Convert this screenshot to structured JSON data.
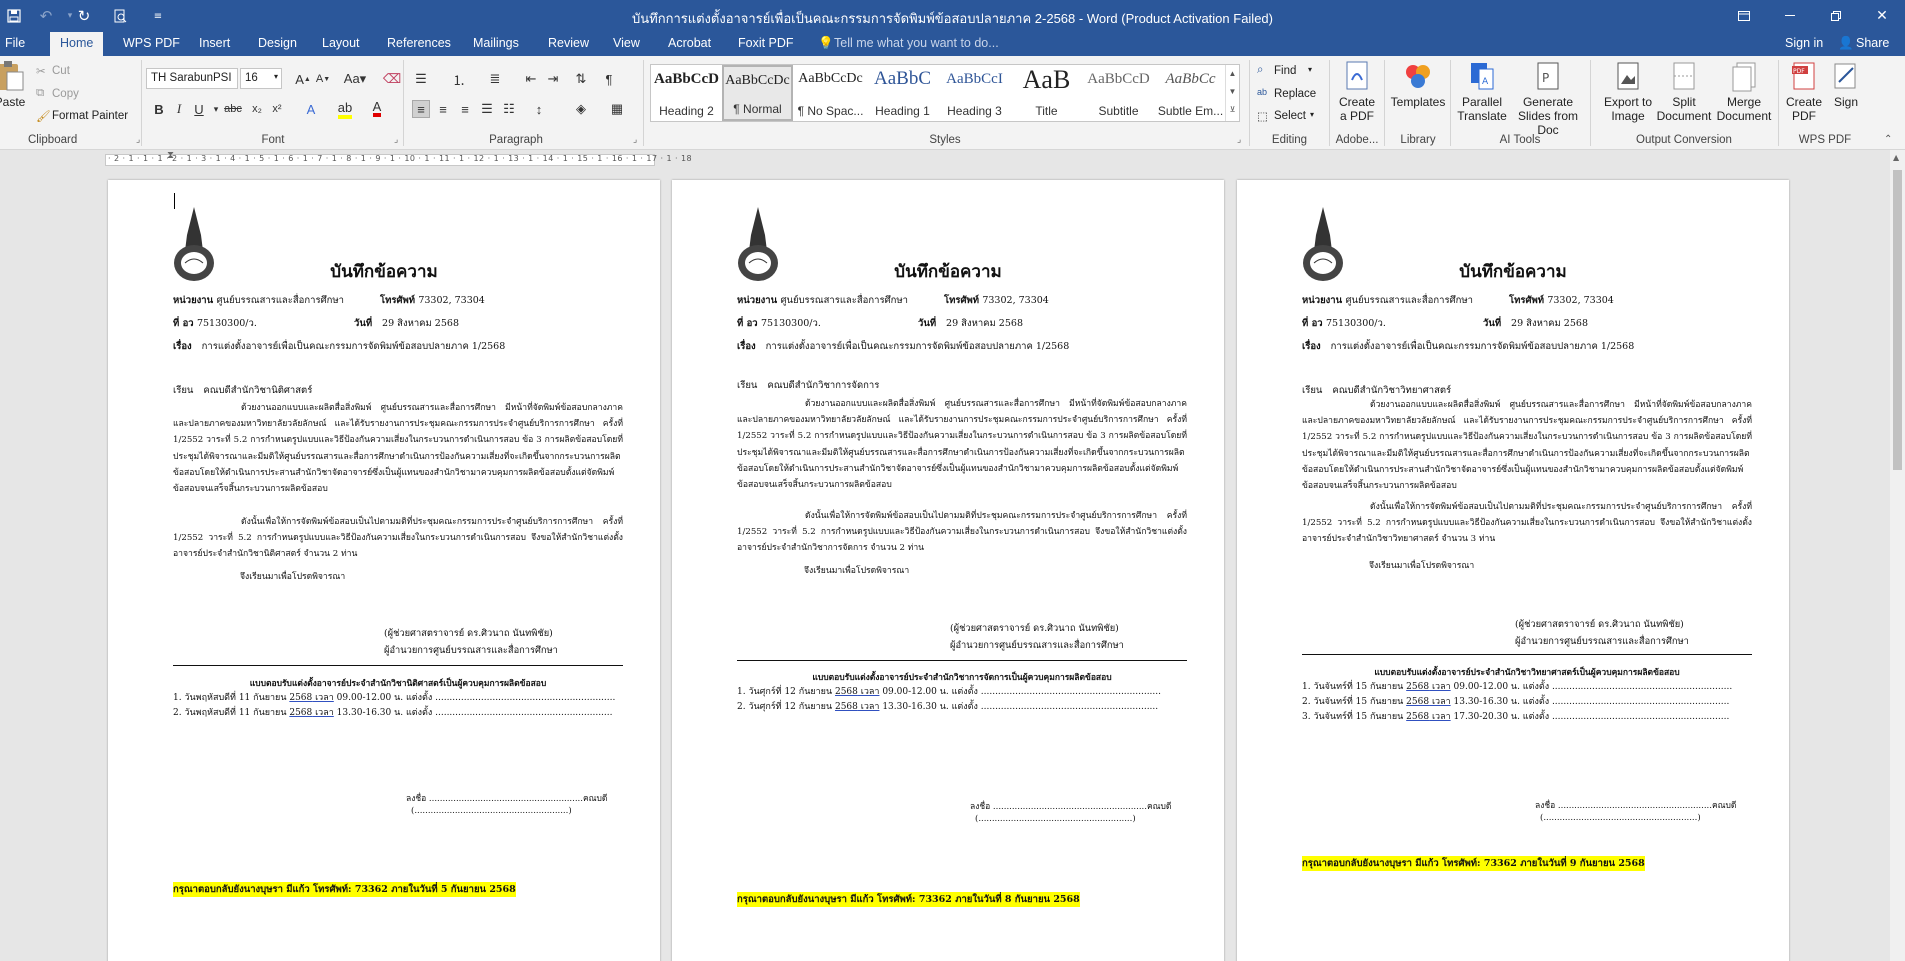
{
  "window": {
    "title": "บันทึกการแต่งตั้งอาจารย์เพื่อเป็นคณะกรรมการจัดพิมพ์ข้อสอบปลายภาค  2-2568 - Word (Product Activation Failed)"
  },
  "tabs": [
    "File",
    "Home",
    "WPS PDF",
    "Insert",
    "Design",
    "Layout",
    "References",
    "Mailings",
    "Review",
    "View",
    "Acrobat",
    "Foxit PDF"
  ],
  "active_tab": "Home",
  "tell_me": "Tell me what you want to do...",
  "account": {
    "sign_in": "Sign in",
    "share": "Share"
  },
  "clipboard": {
    "paste": "Paste",
    "cut": "Cut",
    "copy": "Copy",
    "format_painter": "Format Painter",
    "label": "Clipboard"
  },
  "font": {
    "name": "TH SarabunPSI",
    "size": "16",
    "label": "Font"
  },
  "paragraph": {
    "label": "Paragraph"
  },
  "styles": {
    "label": "Styles",
    "items": [
      {
        "preview": "AaBbCcD",
        "name": "Heading 2"
      },
      {
        "preview": "AaBbCcDc",
        "name": "¶ Normal"
      },
      {
        "preview": "AaBbCcDc",
        "name": "¶ No Spac..."
      },
      {
        "preview": "AaBbC",
        "name": "Heading 1"
      },
      {
        "preview": "AaBbCcI",
        "name": "Heading 3"
      },
      {
        "preview": "AaB",
        "name": "Title"
      },
      {
        "preview": "AaBbCcD",
        "name": "Subtitle"
      },
      {
        "preview": "AaBbCc",
        "name": "Subtle Em..."
      }
    ]
  },
  "editing": {
    "find": "Find",
    "replace": "Replace",
    "select": "Select",
    "label": "Editing"
  },
  "adobe": {
    "create_pdf": "Create a PDF",
    "label": "Adobe..."
  },
  "library": {
    "templates": "Templates",
    "label": "Library"
  },
  "ai_tools": {
    "parallel": "Parallel Translate",
    "slides": "Generate Slides from Doc",
    "label": "AI Tools"
  },
  "output": {
    "export": "Export to Image",
    "split": "Split Document",
    "merge": "Merge Document",
    "label": "Output Conversion"
  },
  "wps_pdf": {
    "create": "Create PDF",
    "sign": "Sign",
    "label": "WPS PDF"
  },
  "ruler_marks": "· 2 · 1 · 1 · 1 · 2 · 1 · 3 · 1 · 4 · 1 · 5 · 1 · 6 · 1 · 7 · 1 · 8 · 1 · 9 · 1 · 10 · 1 · 11 · 1 · 12 · 1 · 13 · 1 · 14 · 1 · 15 · 1 · 16 · 1 · 17 · 1 · 18",
  "pages": [
    {
      "title": "บันทึกข้อความ",
      "dept_label": "หน่วยงาน",
      "dept": "ศูนย์บรรณสารและสื่อการศึกษา",
      "phone_label": "โทรศัพท์",
      "phone": "73302, 73304",
      "ref_label": "ที่ อว",
      "ref": "75130300/ว.",
      "date_label": "วันที่",
      "date": "29 สิงหาคม 2568",
      "subject_label": "เรื่อง",
      "subject": "การแต่งตั้งอาจารย์เพื่อเป็นคณะกรรมการจัดพิมพ์ข้อสอบปลายภาค  1/2568",
      "to_label": "เรียน",
      "to": "คณบดีสำนักวิชานิติศาสตร์",
      "body1": "ด้วยงานออกแบบและผลิตสื่อสิ่งพิมพ์ ศูนย์บรรณสารและสื่อการศึกษา  มีหน้าที่จัดพิมพ์ข้อสอบกลางภาคและปลายภาคของมหาวิทยาลัยวลัยลักษณ์  และได้รับรายงานการประชุมคณะกรรมการประจำศูนย์บริการการศึกษา ครั้งที่ 1/2552 วาระที่ 5.2 การกำหนดรูปแบบและวิธีป้องกันความเสี่ยงในกระบวนการดำเนินการสอบ ข้อ 3 การผลิตข้อสอบโดยที่ประชุมได้พิจารณาและมีมติให้ศูนย์บรรณสารและสื่อการศึกษาดำเนินการป้องกันความเสี่ยงที่จะเกิดขึ้นจากกระบวนการผลิตข้อสอบโดยให้ดำเนินการประสานสำนักวิชาจัดอาจารย์ซึ่งเป็นผู้แทนของสำนักวิชามาควบคุมการผลิตข้อสอบตั้งแต่จัดพิมพ์ข้อสอบจนเสร็จสิ้นกระบวนการผลิตข้อสอบ",
      "body2": "ดังนั้นเพื่อให้การจัดพิมพ์ข้อสอบเป็นไปตามมติที่ประชุมคณะกรรมการประจำศูนย์บริการการศึกษา ครั้งที่ 1/2552 วาระที่ 5.2 การกำหนดรูปแบบและวิธีป้องกันความเสี่ยงในกระบวนการดำเนินการสอบ จึงขอให้สำนักวิชาแต่งตั้งอาจารย์ประจำสำนักวิชานิติศาสตร์ จำนวน 2 ท่าน",
      "closing": "จึงเรียนมาเพื่อโปรดพิจารณา",
      "signer": "(ผู้ช่วยศาสตราจารย์ ดร.ศิวนาถ  นันทพิชัย)",
      "signer_title": "ผู้อำนวยการศูนย์บรรณสารและสื่อการศึกษา",
      "form_title": "แบบตอบรับแต่งตั้งอาจารย์ประจำสำนักวิชานิติศาสตร์เป็นผู้ควบคุมการผลิตข้อสอบ",
      "slots": [
        {
          "pre": "1. วันพฤหัสบดีที่ 11 กันยายน ",
          "yr": "2568",
          "mid": " เวลา",
          "post": " 09.00-12.00 น. แต่งตั้ง ..............................................................."
        },
        {
          "pre": "2. วันพฤหัสบดีที่ 11 กันยายน ",
          "yr": "2568",
          "mid": " เวลา",
          "post": " 13.30-16.30 น. แต่งตั้ง .............................................................."
        }
      ],
      "sign": "ลงชื่อ .........................................................คณบดี",
      "sign_name": "(.........................................................)",
      "highlight": "กรุณาตอบกลับยังนางบุษรา  มีแก้ว โทรศัพท์: 73362 ภายในวันที่  5 กันยายน 2568"
    },
    {
      "title": "บันทึกข้อความ",
      "dept_label": "หน่วยงาน",
      "dept": "ศูนย์บรรณสารและสื่อการศึกษา",
      "phone_label": "โทรศัพท์",
      "phone": "73302, 73304",
      "ref_label": "ที่ อว",
      "ref": "75130300/ว.",
      "date_label": "วันที่",
      "date": "29 สิงหาคม 2568",
      "subject_label": "เรื่อง",
      "subject": "การแต่งตั้งอาจารย์เพื่อเป็นคณะกรรมการจัดพิมพ์ข้อสอบปลายภาค  1/2568",
      "to_label": "เรียน",
      "to": "คณบดีสำนักวิชาการจัดการ",
      "body1": "ด้วยงานออกแบบและผลิตสื่อสิ่งพิมพ์ ศูนย์บรรณสารและสื่อการศึกษา  มีหน้าที่จัดพิมพ์ข้อสอบกลางภาคและปลายภาคของมหาวิทยาลัยวลัยลักษณ์  และได้รับรายงานการประชุมคณะกรรมการประจำศูนย์บริการการศึกษา ครั้งที่ 1/2552 วาระที่ 5.2 การกำหนดรูปแบบและวิธีป้องกันความเสี่ยงในกระบวนการดำเนินการสอบ ข้อ 3 การผลิตข้อสอบโดยที่ประชุมได้พิจารณาและมีมติให้ศูนย์บรรณสารและสื่อการศึกษาดำเนินการป้องกันความเสี่ยงที่จะเกิดขึ้นจากกระบวนการผลิตข้อสอบโดยให้ดำเนินการประสานสำนักวิชาจัดอาจารย์ซึ่งเป็นผู้แทนของสำนักวิชามาควบคุมการผลิตข้อสอบตั้งแต่จัดพิมพ์ข้อสอบจนเสร็จสิ้นกระบวนการผลิตข้อสอบ",
      "body2": "ดังนั้นเพื่อให้การจัดพิมพ์ข้อสอบเป็นไปตามมติที่ประชุมคณะกรรมการประจำศูนย์บริการการศึกษา ครั้งที่ 1/2552 วาระที่ 5.2 การกำหนดรูปแบบและวิธีป้องกันความเสี่ยงในกระบวนการดำเนินการสอบ จึงขอให้สำนักวิชาแต่งตั้งอาจารย์ประจำสำนักวิชาการจัดการ จำนวน 2 ท่าน",
      "closing": "จึงเรียนมาเพื่อโปรดพิจารณา",
      "signer": "(ผู้ช่วยศาสตราจารย์ ดร.ศิวนาถ  นันทพิชัย)",
      "signer_title": "ผู้อำนวยการศูนย์บรรณสารและสื่อการศึกษา",
      "form_title": "แบบตอบรับแต่งตั้งอาจารย์ประจำสำนักวิชาการจัดการเป็นผู้ควบคุมการผลิตข้อสอบ",
      "slots": [
        {
          "pre": "1. วันศุกร์ที่ 12 กันยายน ",
          "yr": "2568",
          "mid": " เวลา",
          "post": " 09.00-12.00 น. แต่งตั้ง ..............................................................."
        },
        {
          "pre": "2. วันศุกร์ที่ 12 กันยายน ",
          "yr": "2568",
          "mid": " เวลา",
          "post": " 13.30-16.30 น. แต่งตั้ง .............................................................."
        }
      ],
      "sign": "ลงชื่อ .........................................................คณบดี",
      "sign_name": "(.........................................................)",
      "highlight": "กรุณาตอบกลับยังนางบุษรา  มีแก้ว โทรศัพท์: 73362 ภายในวันที่  8 กันยายน 2568"
    },
    {
      "title": "บันทึกข้อความ",
      "dept_label": "หน่วยงาน",
      "dept": "ศูนย์บรรณสารและสื่อการศึกษา",
      "phone_label": "โทรศัพท์",
      "phone": "73302, 73304",
      "ref_label": "ที่ อว",
      "ref": "75130300/ว.",
      "date_label": "วันที่",
      "date": "29 สิงหาคม 2568",
      "subject_label": "เรื่อง",
      "subject": "การแต่งตั้งอาจารย์เพื่อเป็นคณะกรรมการจัดพิมพ์ข้อสอบปลายภาค  1/2568",
      "to_label": "เรียน",
      "to": "คณบดีสำนักวิชาวิทยาศาสตร์",
      "body1": "ด้วยงานออกแบบและผลิตสื่อสิ่งพิมพ์ ศูนย์บรรณสารและสื่อการศึกษา  มีหน้าที่จัดพิมพ์ข้อสอบกลางภาคและปลายภาคของมหาวิทยาลัยวลัยลักษณ์  และได้รับรายงานการประชุมคณะกรรมการประจำศูนย์บริการการศึกษา ครั้งที่ 1/2552 วาระที่ 5.2 การกำหนดรูปแบบและวิธีป้องกันความเสี่ยงในกระบวนการดำเนินการสอบ ข้อ 3 การผลิตข้อสอบโดยที่ประชุมได้พิจารณาและมีมติให้ศูนย์บรรณสารและสื่อการศึกษาดำเนินการป้องกันความเสี่ยงที่จะเกิดขึ้นจากกระบวนการผลิตข้อสอบโดยให้ดำเนินการประสานสำนักวิชาจัดอาจารย์ซึ่งเป็นผู้แทนของสำนักวิชามาควบคุมการผลิตข้อสอบตั้งแต่จัดพิมพ์ข้อสอบจนเสร็จสิ้นกระบวนการผลิตข้อสอบ",
      "body2": "ดังนั้นเพื่อให้การจัดพิมพ์ข้อสอบเป็นไปตามมติที่ประชุมคณะกรรมการประจำศูนย์บริการการศึกษา ครั้งที่ 1/2552 วาระที่ 5.2 การกำหนดรูปแบบและวิธีป้องกันความเสี่ยงในกระบวนการดำเนินการสอบ จึงขอให้สำนักวิชาแต่งตั้งอาจารย์ประจำสำนักวิชาวิทยาศาสตร์ จำนวน 3 ท่าน",
      "closing": "จึงเรียนมาเพื่อโปรดพิจารณา",
      "signer": "(ผู้ช่วยศาสตราจารย์ ดร.ศิวนาถ  นันทพิชัย)",
      "signer_title": "ผู้อำนวยการศูนย์บรรณสารและสื่อการศึกษา",
      "form_title": "แบบตอบรับแต่งตั้งอาจารย์ประจำสำนักวิชาวิทยาศาสตร์เป็นผู้ควบคุมการผลิตข้อสอบ",
      "slots": [
        {
          "pre": "1. วันจันทร์ที่ 15 กันยายน ",
          "yr": "2568",
          "mid": " เวลา",
          "post": " 09.00-12.00 น. แต่งตั้ง ..............................................................."
        },
        {
          "pre": "2. วันจันทร์ที่ 15 กันยายน ",
          "yr": "2568",
          "mid": " เวลา",
          "post": " 13.30-16.30 น. แต่งตั้ง .............................................................."
        },
        {
          "pre": "3. วันจันทร์ที่ 15 กันยายน ",
          "yr": "2568",
          "mid": " เวลา",
          "post": " 17.30-20.30 น. แต่งตั้ง .............................................................."
        }
      ],
      "sign": "ลงชื่อ .........................................................คณบดี",
      "sign_name": "(.........................................................)",
      "highlight": "กรุณาตอบกลับยังนางบุษรา  มีแก้ว โทรศัพท์: 73362 ภายในวันที่  9 กันยายน 2568"
    }
  ]
}
